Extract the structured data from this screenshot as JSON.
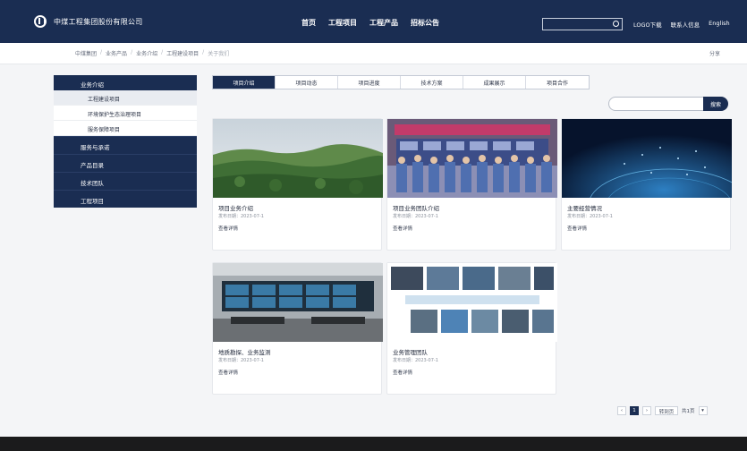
{
  "header": {
    "company_name": "中煤工程集团股份有限公司",
    "nav": [
      "首页",
      "工程项目",
      "工程产品",
      "招标公告"
    ],
    "links": [
      "LOGO下载",
      "联系人信息",
      "English"
    ]
  },
  "breadcrumb": {
    "items": [
      "中煤集团",
      "业务产品",
      "业务介绍",
      "工程建设项目"
    ],
    "current": "关于我们",
    "share_label": "分享"
  },
  "sidebar": {
    "head": "业务介绍",
    "subs": [
      "工程建设项目",
      "环境保护生态治理项目",
      "服务保障项目"
    ],
    "items": [
      "服务与承诺",
      "产品目录",
      "技术团队",
      "工程项目"
    ]
  },
  "tabs": [
    "项目介绍",
    "项目动态",
    "项目进度",
    "技术方案",
    "成果展示",
    "项目合作"
  ],
  "filter": {
    "button_label": "搜索"
  },
  "cards": [
    {
      "title": "项目业务介绍",
      "meta": "发布日期：2023-07-1",
      "more": "查看详情"
    },
    {
      "title": "项目业务团队介绍",
      "meta": "发布日期：2023-07-1",
      "more": "查看详情"
    },
    {
      "title": "主要经营情况",
      "meta": "发布日期：2023-07-1",
      "more": "查看详情"
    },
    {
      "title": "地质勘探、业务监测",
      "meta": "发布日期：2023-07-1",
      "more": "查看详情"
    },
    {
      "title": "业务管理团队",
      "meta": "发布日期：2023-07-1",
      "more": "查看详情"
    }
  ],
  "pager": {
    "current": "1",
    "goto_label": "转到页",
    "total": "共1页"
  },
  "colors": {
    "navy": "#1a2d52",
    "footer": "#1b1b1c"
  }
}
